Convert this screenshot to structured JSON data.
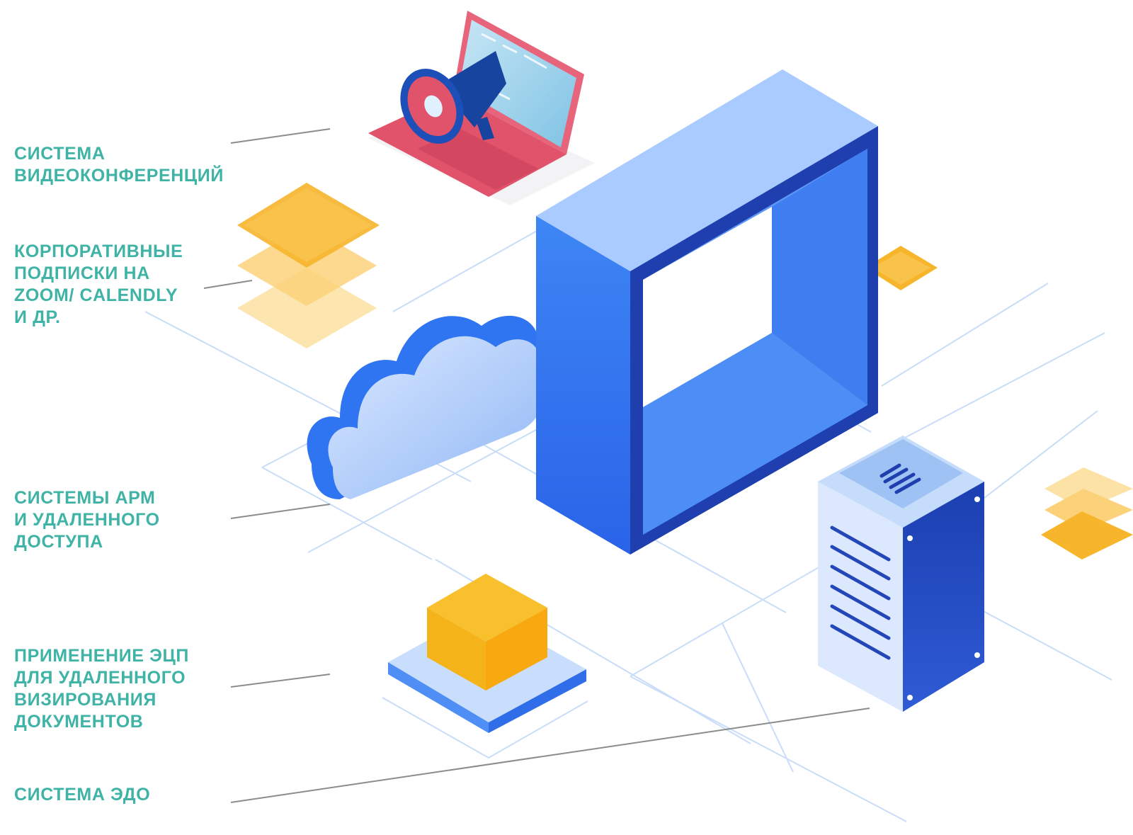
{
  "colors": {
    "label_text": "#3fb3a5",
    "accent_blue": "#2f74f0",
    "dark_blue": "#1f3fae",
    "light_blue": "#a9cbff",
    "yellow": "#f6b52a",
    "pink": "#e0536a",
    "grid_line": "#c9dcf8",
    "leader_line": "#8c8c8c"
  },
  "labels": [
    {
      "id": "video",
      "lines": [
        "Система",
        "видеоконференций"
      ]
    },
    {
      "id": "subscriptions",
      "lines": [
        "Корпоративные",
        "подписки на",
        "ZOOM/ CALENDLY",
        "и др."
      ]
    },
    {
      "id": "remote",
      "lines": [
        "Системы АРМ",
        "и удаленного",
        "доступа"
      ]
    },
    {
      "id": "signature",
      "lines": [
        "Применение ЭЦП",
        "для удаленного",
        "визирования",
        "документов"
      ]
    },
    {
      "id": "edo",
      "lines": [
        "Система ЭДО"
      ]
    }
  ],
  "icons": [
    "laptop-megaphone-icon",
    "cloud-icon",
    "frame-icon",
    "server-rack-icon",
    "yellow-cube-icon",
    "yellow-stack-icon"
  ]
}
